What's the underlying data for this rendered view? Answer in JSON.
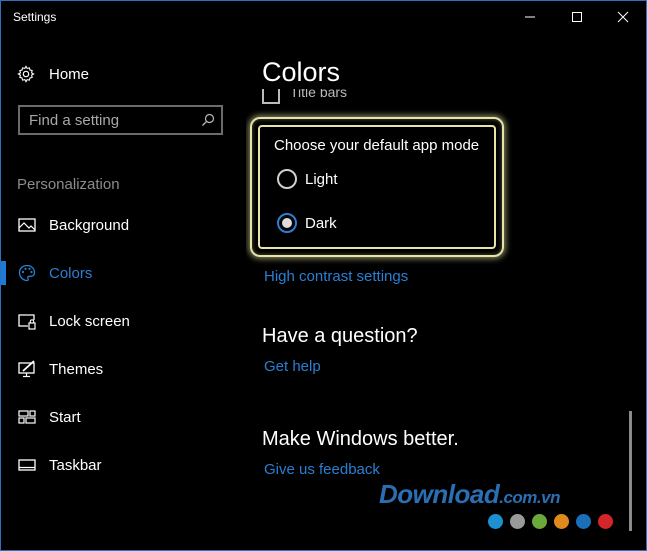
{
  "window": {
    "title": "Settings",
    "controls": {
      "minimize": "minimize-icon",
      "maximize": "maximize-icon",
      "close": "close-icon"
    }
  },
  "sidebar": {
    "home": {
      "label": "Home",
      "icon": "gear-icon"
    },
    "search": {
      "placeholder": "Find a setting",
      "value": "",
      "icon": "search-icon"
    },
    "section_label": "Personalization",
    "items": [
      {
        "label": "Background",
        "icon": "picture-icon",
        "active": false
      },
      {
        "label": "Colors",
        "icon": "palette-icon",
        "active": true
      },
      {
        "label": "Lock screen",
        "icon": "lock-screen-icon",
        "active": false
      },
      {
        "label": "Themes",
        "icon": "themes-icon",
        "active": false
      },
      {
        "label": "Start",
        "icon": "start-icon",
        "active": false
      },
      {
        "label": "Taskbar",
        "icon": "taskbar-icon",
        "active": false
      }
    ]
  },
  "main": {
    "page_title": "Colors",
    "title_bars_checkbox": {
      "label": "Title bars",
      "checked": false
    },
    "app_mode": {
      "label": "Choose your default app mode",
      "options": [
        {
          "label": "Light",
          "checked": false
        },
        {
          "label": "Dark",
          "checked": true
        }
      ]
    },
    "high_contrast_link": "High contrast settings",
    "question": {
      "heading": "Have a question?",
      "link": "Get help"
    },
    "feedback": {
      "heading": "Make Windows better.",
      "link": "Give us feedback"
    }
  },
  "watermark": {
    "brand": "Download",
    "suffix": ".com.vn",
    "dot_colors": [
      "#1e8fd0",
      "#9a9a9a",
      "#6aa93a",
      "#e08a1e",
      "#1b6fb8",
      "#d4252a"
    ]
  },
  "colors": {
    "accent": "#2a7fd4",
    "background": "#000000",
    "highlight_glow": "#e6e4a8"
  }
}
